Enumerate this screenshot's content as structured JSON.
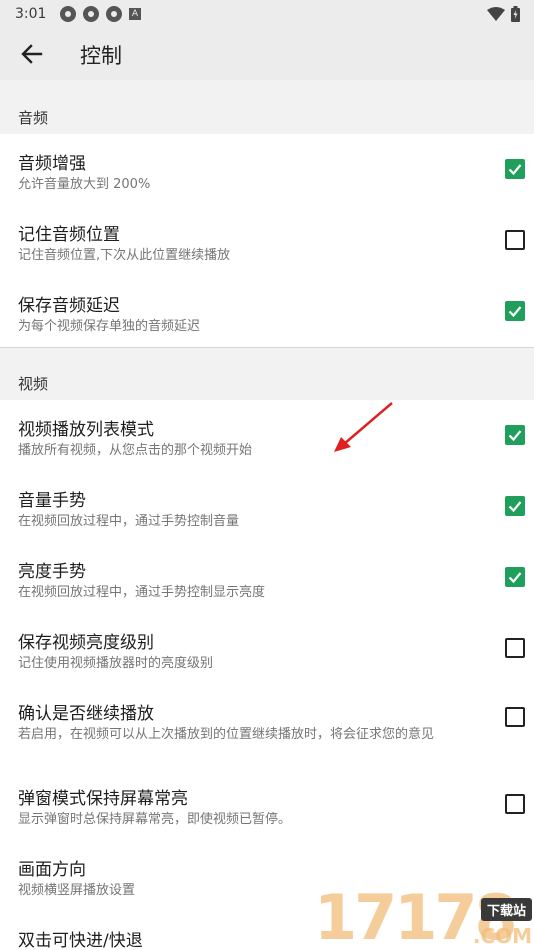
{
  "status_bar": {
    "time": "3:01",
    "a_label": "A"
  },
  "app_bar": {
    "title": "控制"
  },
  "sections": [
    {
      "header": "音频",
      "items": [
        {
          "title": "音频增强",
          "summary": "允许音量放大到 200%",
          "checked": true
        },
        {
          "title": "记住音频位置",
          "summary": "记住音频位置,下次从此位置继续播放",
          "checked": false
        },
        {
          "title": "保存音频延迟",
          "summary": "为每个视频保存单独的音频延迟",
          "checked": true
        }
      ]
    },
    {
      "header": "视频",
      "items": [
        {
          "title": "视频播放列表模式",
          "summary": "播放所有视频，从您点击的那个视频开始",
          "checked": true
        },
        {
          "title": "音量手势",
          "summary": "在视频回放过程中，通过手势控制音量",
          "checked": true
        },
        {
          "title": "亮度手势",
          "summary": "在视频回放过程中，通过手势控制显示亮度",
          "checked": true
        },
        {
          "title": "保存视频亮度级别",
          "summary": "记住使用视频播放器时的亮度级别",
          "checked": false
        },
        {
          "title": "确认是否继续播放",
          "summary": "若启用，在视频可以从上次播放到的位置继续播放时，将会征求您的意见",
          "checked": false
        },
        {
          "title": "弹窗模式保持屏幕常亮",
          "summary": "显示弹窗时总保持屏幕常亮，即使视频已暂停。",
          "checked": false
        },
        {
          "title": "画面方向",
          "summary": "视频横竖屏播放设置"
        },
        {
          "title": "双击可快进/快退"
        }
      ]
    }
  ],
  "watermark": {
    "digits": "17178",
    "badge": "下载站",
    "suffix": ".COM"
  },
  "colors": {
    "accent": "#1f9e5c",
    "annotation_arrow": "#e02020",
    "watermark": "#f1bd7a"
  }
}
